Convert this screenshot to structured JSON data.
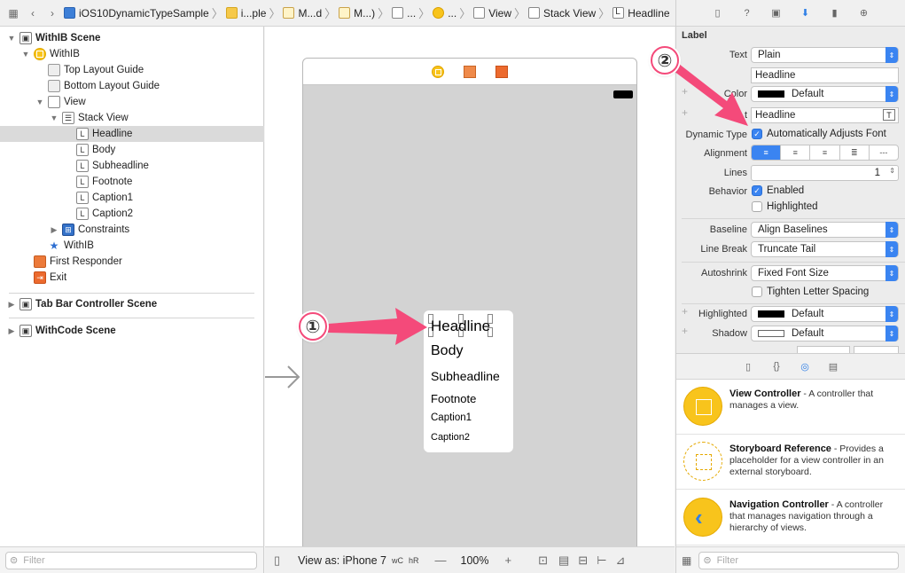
{
  "breadcrumbs": [
    "iOS10DynamicTypeSample",
    "i...ple",
    "M...d",
    "M...)",
    "...",
    "...",
    "View",
    "Stack View",
    "Headline"
  ],
  "navigator": {
    "rows": [
      {
        "label": "WithIB Scene"
      },
      {
        "label": "WithIB"
      },
      {
        "label": "Top Layout Guide"
      },
      {
        "label": "Bottom Layout Guide"
      },
      {
        "label": "View"
      },
      {
        "label": "Stack View"
      },
      {
        "label": "Headline"
      },
      {
        "label": "Body"
      },
      {
        "label": "Subheadline"
      },
      {
        "label": "Footnote"
      },
      {
        "label": "Caption1"
      },
      {
        "label": "Caption2"
      },
      {
        "label": "Constraints"
      },
      {
        "label": "WithIB"
      },
      {
        "label": "First Responder"
      },
      {
        "label": "Exit"
      },
      {
        "label": "Tab Bar Controller Scene"
      },
      {
        "label": "WithCode Scene"
      }
    ],
    "filter_placeholder": "Filter"
  },
  "canvas": {
    "stack_labels": [
      "Headline",
      "Body",
      "Subheadline",
      "Footnote",
      "Caption1",
      "Caption2"
    ],
    "view_as": "View as: iPhone 7",
    "size_class_w": "wC",
    "size_class_h": "hR",
    "zoom": "100%"
  },
  "inspector": {
    "section": "Label",
    "text_label": "Text",
    "text_type": "Plain",
    "text_value": "Headline",
    "color_label": "Color",
    "color_value": "Default",
    "font_label": "t",
    "font_value": "Headline",
    "dynamic_type_label": "Dynamic Type",
    "auto_adjust": "Automatically Adjusts Font",
    "alignment_label": "Alignment",
    "lines_label": "Lines",
    "lines_value": "1",
    "behavior_label": "Behavior",
    "enabled": "Enabled",
    "highlighted_cb": "Highlighted",
    "baseline_label": "Baseline",
    "baseline_value": "Align Baselines",
    "linebreak_label": "Line Break",
    "linebreak_value": "Truncate Tail",
    "autoshrink_label": "Autoshrink",
    "autoshrink_value": "Fixed Font Size",
    "tighten": "Tighten Letter Spacing",
    "highlighted_label": "Highlighted",
    "highlighted_value": "Default",
    "shadow_label": "Shadow",
    "shadow_value": "Default"
  },
  "library": {
    "items": [
      {
        "title": "View Controller",
        "desc": " - A controller that manages a view."
      },
      {
        "title": "Storyboard Reference",
        "desc": " - Provides a placeholder for a view controller in an external storyboard."
      },
      {
        "title": "Navigation Controller",
        "desc": " - A controller that manages navigation through a hierarchy of views."
      }
    ],
    "filter_placeholder": "Filter"
  },
  "callouts": [
    "①",
    "②"
  ],
  "colors": {
    "accent": "#3a84f1",
    "annotation": "#f44a7a",
    "vc_yellow": "#f8c41c"
  }
}
